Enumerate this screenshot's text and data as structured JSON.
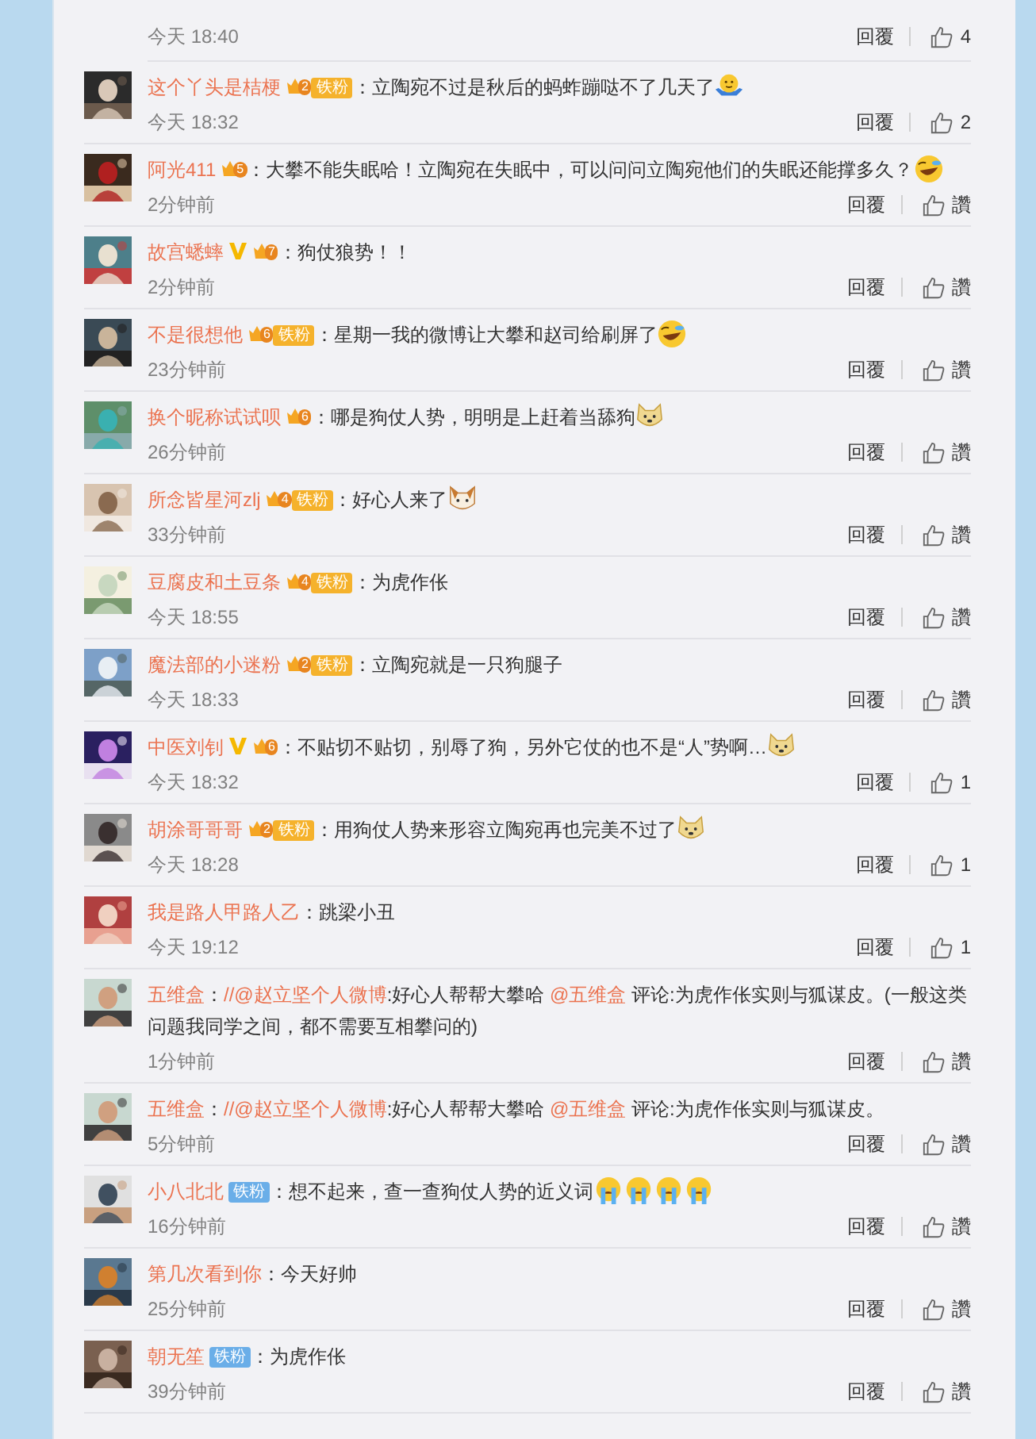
{
  "top_fragment": {
    "time": "今天 18:40",
    "reply": "回覆",
    "like": "4"
  },
  "comments": [
    {
      "name": "这个丫头是桔梗",
      "verified": false,
      "fan_level": "2",
      "fan_tag": {
        "text": "铁粉",
        "color": "#f5b22c"
      },
      "body": [
        {
          "kind": "text",
          "text": "：立陶宛不过是秋后的蚂蚱蹦哒不了几天了"
        }
      ],
      "emojis": [
        {
          "kind": "shrug"
        }
      ],
      "time": "今天 18:32",
      "reply": "回覆",
      "like": "2"
    },
    {
      "name": "阿光411",
      "verified": false,
      "fan_level": "5",
      "body": [
        {
          "kind": "text",
          "text": "：大攀不能失眠哈！立陶宛在失眠中，可以问问立陶宛他们的失眠还能撑多久？"
        }
      ],
      "emojis": [
        {
          "kind": "laugh-cry"
        }
      ],
      "time": "2分钟前",
      "reply": "回覆",
      "like": "讚"
    },
    {
      "name": "故宫蟋蟀",
      "verified": true,
      "fan_level": "7",
      "body": [
        {
          "kind": "text",
          "text": "：狗仗狼势！！"
        }
      ],
      "time": "2分钟前",
      "reply": "回覆",
      "like": "讚"
    },
    {
      "name": "不是很想他",
      "verified": false,
      "fan_level": "6",
      "fan_tag": {
        "text": "铁粉",
        "color": "#f5b22c"
      },
      "body": [
        {
          "kind": "text",
          "text": "：星期一我的微博让大攀和赵司给刷屏了"
        }
      ],
      "emojis": [
        {
          "kind": "laugh-cry"
        }
      ],
      "time": "23分钟前",
      "reply": "回覆",
      "like": "讚"
    },
    {
      "name": "换个昵称试试呗",
      "verified": false,
      "fan_level": "6",
      "body": [
        {
          "kind": "text",
          "text": "：哪是狗仗人势，明明是上赶着当舔狗"
        }
      ],
      "emojis": [
        {
          "kind": "doge"
        }
      ],
      "time": "26分钟前",
      "reply": "回覆",
      "like": "讚"
    },
    {
      "name": "所念皆星河zlj",
      "verified": false,
      "fan_level": "4",
      "fan_tag": {
        "text": "铁粉",
        "color": "#f5b22c"
      },
      "body": [
        {
          "kind": "text",
          "text": "：好心人来了"
        }
      ],
      "emojis": [
        {
          "kind": "cat"
        }
      ],
      "time": "33分钟前",
      "reply": "回覆",
      "like": "讚"
    },
    {
      "name": "豆腐皮和土豆条",
      "verified": false,
      "fan_level": "4",
      "fan_tag": {
        "text": "铁粉",
        "color": "#f5b22c"
      },
      "body": [
        {
          "kind": "text",
          "text": "：为虎作伥"
        }
      ],
      "time": "今天 18:55",
      "reply": "回覆",
      "like": "讚"
    },
    {
      "name": "魔法部的小迷粉",
      "verified": false,
      "fan_level": "2",
      "fan_tag": {
        "text": "铁粉",
        "color": "#f5b22c"
      },
      "body": [
        {
          "kind": "text",
          "text": "：立陶宛就是一只狗腿子"
        }
      ],
      "time": "今天 18:33",
      "reply": "回覆",
      "like": "讚"
    },
    {
      "name": "中医刘钊",
      "verified": true,
      "fan_level": "6",
      "body": [
        {
          "kind": "text",
          "text": "：不贴切不贴切，别辱了狗，另外它仗的也不是“人”势啊…"
        }
      ],
      "emojis": [
        {
          "kind": "doge"
        }
      ],
      "time": "今天 18:32",
      "reply": "回覆",
      "like": "1"
    },
    {
      "name": "胡涂哥哥哥",
      "verified": false,
      "fan_level": "2",
      "fan_tag": {
        "text": "铁粉",
        "color": "#f5b22c"
      },
      "body": [
        {
          "kind": "text",
          "text": "：用狗仗人势来形容立陶宛再也完美不过了"
        }
      ],
      "emojis": [
        {
          "kind": "doge"
        }
      ],
      "time": "今天 18:28",
      "reply": "回覆",
      "like": "1"
    },
    {
      "name": "我是路人甲路人乙",
      "verified": false,
      "body": [
        {
          "kind": "text",
          "text": "：跳梁小丑"
        }
      ],
      "time": "今天 19:12",
      "reply": "回覆",
      "like": "1"
    },
    {
      "name": "五维盒",
      "verified": false,
      "body": [
        {
          "kind": "text",
          "text": "："
        },
        {
          "kind": "mention",
          "text": "//@赵立坚个人微博"
        },
        {
          "kind": "text",
          "text": ":好心人帮帮大攀哈 "
        },
        {
          "kind": "mention",
          "text": "@五维盒"
        },
        {
          "kind": "text",
          "text": " 评论:为虎作伥实则与狐谋皮。(一般这类"
        }
      ],
      "continuation": "问题我同学之间，都不需要互相攀问的)",
      "time": "1分钟前",
      "reply": "回覆",
      "like": "讚"
    },
    {
      "name": "五维盒",
      "verified": false,
      "body": [
        {
          "kind": "text",
          "text": "："
        },
        {
          "kind": "mention",
          "text": "//@赵立坚个人微博"
        },
        {
          "kind": "text",
          "text": ":好心人帮帮大攀哈 "
        },
        {
          "kind": "mention",
          "text": "@五维盒"
        },
        {
          "kind": "text",
          "text": " 评论:为虎作伥实则与狐谋皮。"
        }
      ],
      "time": "5分钟前",
      "reply": "回覆",
      "like": "讚"
    },
    {
      "name": "小八北北",
      "verified": false,
      "fan_tag": {
        "text": "铁粉",
        "color": "#6aaee8"
      },
      "body": [
        {
          "kind": "text",
          "text": "：想不起来，查一查狗仗人势的近义词"
        }
      ],
      "emojis": [
        {
          "kind": "tears"
        },
        {
          "kind": "tears"
        },
        {
          "kind": "tears"
        },
        {
          "kind": "tears"
        }
      ],
      "time": "16分钟前",
      "reply": "回覆",
      "like": "讚"
    },
    {
      "name": "第几次看到你",
      "verified": false,
      "body": [
        {
          "kind": "text",
          "text": "：今天好帅"
        }
      ],
      "time": "25分钟前",
      "reply": "回覆",
      "like": "讚"
    },
    {
      "name": "朝无笙",
      "verified": false,
      "fan_tag": {
        "text": "铁粉",
        "color": "#6aaee8"
      },
      "body": [
        {
          "kind": "text",
          "text": "：为虎作伥"
        }
      ],
      "time": "39分钟前",
      "reply": "回覆",
      "like": "讚"
    }
  ]
}
